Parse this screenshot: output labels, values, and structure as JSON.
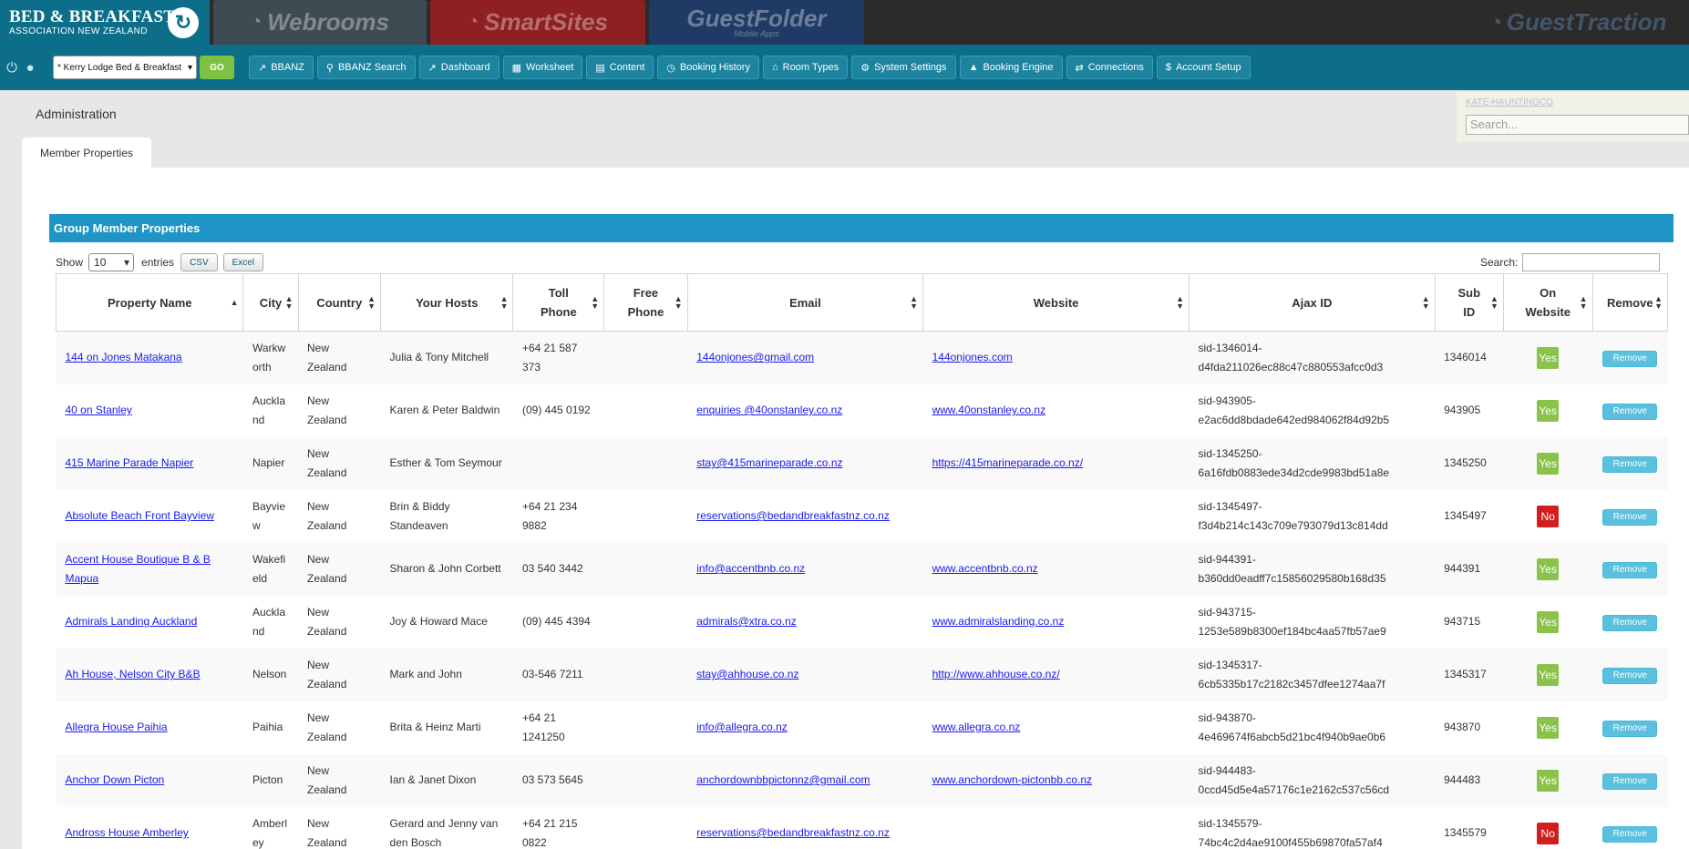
{
  "brand": {
    "main": "BED & BREAKFAST",
    "sub": "ASSOCIATION NEW ZEALAND"
  },
  "products": [
    {
      "label": "Webrooms"
    },
    {
      "label": "SmartSites"
    },
    {
      "label": "GuestFolder",
      "sub": "Mobile Apps"
    },
    {
      "label": "GuestTraction"
    }
  ],
  "nav": {
    "property_select": "* Kerry Lodge Bed & Breakfast",
    "go_label": "GO",
    "buttons": [
      {
        "label": "BBANZ",
        "icon": "chart-line-icon"
      },
      {
        "label": "BBANZ Search",
        "icon": "search-icon"
      },
      {
        "label": "Dashboard",
        "icon": "chart-line-icon"
      },
      {
        "label": "Worksheet",
        "icon": "grid-icon"
      },
      {
        "label": "Content",
        "icon": "document-icon"
      },
      {
        "label": "Booking History",
        "icon": "history-icon"
      },
      {
        "label": "Room Types",
        "icon": "home-icon"
      },
      {
        "label": "System Settings",
        "icon": "gear-icon"
      },
      {
        "label": "Booking Engine",
        "icon": "bell-icon"
      },
      {
        "label": "Connections",
        "icon": "connections-icon"
      },
      {
        "label": "Account Setup",
        "icon": "dollar-icon"
      }
    ]
  },
  "admin": {
    "title": "Administration",
    "user_link": "KATE-HAUNTINGCO",
    "search_placeholder": "Search..."
  },
  "tab": {
    "label": "Member Properties"
  },
  "panel": {
    "title": "Group Member Properties"
  },
  "controls": {
    "show": "Show",
    "entries_value": "10",
    "entries": "entries",
    "csv": "CSV",
    "excel": "Excel",
    "search_label": "Search:"
  },
  "table": {
    "headers": [
      {
        "l1": "Property Name",
        "l2": ""
      },
      {
        "l1": "City",
        "l2": ""
      },
      {
        "l1": "Country",
        "l2": ""
      },
      {
        "l1": "Your Hosts",
        "l2": ""
      },
      {
        "l1": "Toll",
        "l2": "Phone"
      },
      {
        "l1": "Free",
        "l2": "Phone"
      },
      {
        "l1": "Email",
        "l2": ""
      },
      {
        "l1": "Website",
        "l2": ""
      },
      {
        "l1": "Ajax ID",
        "l2": ""
      },
      {
        "l1": "Sub",
        "l2": "ID"
      },
      {
        "l1": "On",
        "l2": "Website"
      },
      {
        "l1": "Remove",
        "l2": ""
      }
    ],
    "rows": [
      {
        "name": "144 on Jones Matakana",
        "city": "Warkworth",
        "country": "New Zealand",
        "hosts": "Julia & Tony Mitchell",
        "toll": "+64 21 587 373",
        "free": "",
        "email": "144onjones@gmail.com",
        "website": "144onjones.com",
        "ajax": "sid-1346014-d4fda211026ec88c47c880553afcc0d3",
        "sub": "1346014",
        "on": "Yes",
        "remove": "Remove"
      },
      {
        "name": "40 on Stanley",
        "city": "Auckland",
        "country": "New Zealand",
        "hosts": "Karen & Peter Baldwin",
        "toll": "(09) 445 0192",
        "free": "",
        "email": "enquiries @40onstanley.co.nz",
        "website": "www.40onstanley.co.nz",
        "ajax": "sid-943905-e2ac6dd8bdade642ed984062f84d92b5",
        "sub": "943905",
        "on": "Yes",
        "remove": "Remove"
      },
      {
        "name": "415 Marine Parade Napier",
        "city": "Napier",
        "country": "New Zealand",
        "hosts": "Esther & Tom Seymour",
        "toll": "",
        "free": "",
        "email": "stay@415marineparade.co.nz",
        "website": "https://415marineparade.co.nz/",
        "ajax": "sid-1345250-6a16fdb0883ede34d2cde9983bd51a8e",
        "sub": "1345250",
        "on": "Yes",
        "remove": "Remove"
      },
      {
        "name": "Absolute Beach Front Bayview",
        "city": "Bayview",
        "country": "New Zealand",
        "hosts": "Brin & Biddy Standeaven",
        "toll": "+64 21 234 9882",
        "free": "",
        "email": "reservations@bedandbreakfastnz.co.nz",
        "website": "",
        "ajax": "sid-1345497-f3d4b214c143c709e793079d13c814dd",
        "sub": "1345497",
        "on": "No",
        "remove": "Remove"
      },
      {
        "name": "Accent House Boutique B & B Mapua",
        "city": "Wakefield",
        "country": "New Zealand",
        "hosts": "Sharon & John Corbett",
        "toll": "03 540 3442",
        "free": "",
        "email": "info@accentbnb.co.nz",
        "website": "www.accentbnb.co.nz",
        "ajax": "sid-944391-b360dd0eadff7c15856029580b168d35",
        "sub": "944391",
        "on": "Yes",
        "remove": "Remove"
      },
      {
        "name": "Admirals Landing Auckland",
        "city": "Auckland",
        "country": "New Zealand",
        "hosts": "Joy & Howard Mace",
        "toll": "(09) 445 4394",
        "free": "",
        "email": "admirals@xtra.co.nz",
        "website": "www.admiralslanding.co.nz",
        "ajax": "sid-943715-1253e589b8300ef184bc4aa57fb57ae9",
        "sub": "943715",
        "on": "Yes",
        "remove": "Remove"
      },
      {
        "name": "Ah House, Nelson City B&B",
        "city": "Nelson",
        "country": "New Zealand",
        "hosts": "Mark and John",
        "toll": "03-546 7211",
        "free": "",
        "email": "stay@ahhouse.co.nz",
        "website": "http://www.ahhouse.co.nz/",
        "ajax": "sid-1345317-6cb5335b17c2182c3457dfee1274aa7f",
        "sub": "1345317",
        "on": "Yes",
        "remove": "Remove"
      },
      {
        "name": "Allegra House Paihia",
        "city": "Paihia",
        "country": "New Zealand",
        "hosts": "Brita & Heinz Marti",
        "toll": "+64 21 1241250",
        "free": "",
        "email": "info@allegra.co.nz",
        "website": "www.allegra.co.nz",
        "ajax": "sid-943870-4e469674f6abcb5d21bc4f940b9ae0b6",
        "sub": "943870",
        "on": "Yes",
        "remove": "Remove"
      },
      {
        "name": "Anchor Down Picton",
        "city": "Picton",
        "country": "New Zealand",
        "hosts": "Ian & Janet Dixon",
        "toll": "03 573 5645",
        "free": "",
        "email": "anchordownbbpictonnz@gmail.com",
        "website": "www.anchordown-pictonbb.co.nz",
        "ajax": "sid-944483-0ccd45d5e4a57176c1e2162c537c56cd",
        "sub": "944483",
        "on": "Yes",
        "remove": "Remove"
      },
      {
        "name": "Andross House Amberley",
        "city": "Amberley",
        "country": "New Zealand",
        "hosts": "Gerard and Jenny van den Bosch",
        "toll": "+64 21 215 0822",
        "free": "",
        "email": "reservations@bedandbreakfastnz.co.nz",
        "website": "",
        "ajax": "sid-1345579-74bc4c2d4ae9100f455b69870fa57af4",
        "sub": "1345579",
        "on": "No",
        "remove": "Remove"
      }
    ]
  }
}
